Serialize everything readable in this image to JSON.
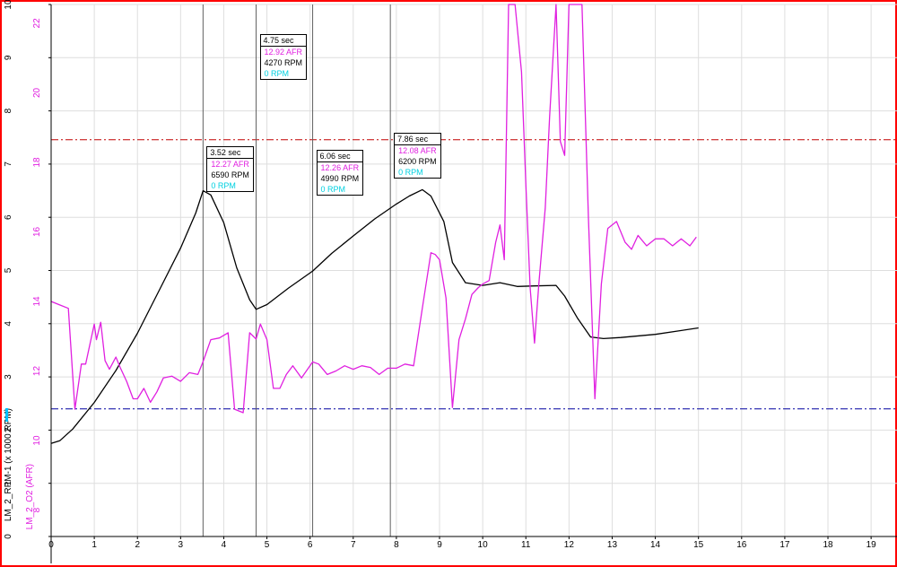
{
  "chart_data": {
    "type": "line",
    "xlabel": "",
    "x_ticks": [
      0,
      1,
      2,
      3,
      4,
      5,
      6,
      7,
      8,
      9,
      10,
      11,
      12,
      13,
      14,
      15,
      16,
      17,
      18,
      19
    ],
    "xlim": [
      0,
      19.6
    ],
    "axes": {
      "rpm": {
        "label": "LM_2_RPM-1 (x 1000 RPM)",
        "color": "#000000",
        "ticks": [
          0,
          1,
          2,
          3,
          4,
          5,
          6,
          7,
          8,
          9,
          10
        ],
        "ylim": [
          0,
          10
        ]
      },
      "afr": {
        "label": "LM_2_O2 (AFR)",
        "color": "#e020e0",
        "ticks": [
          8,
          10,
          12,
          14,
          16,
          18,
          20,
          22
        ],
        "ylim": [
          7.24,
          22.54
        ]
      }
    },
    "reference_lines": [
      {
        "axis": "afr",
        "value": 18.65,
        "color": "#c00000"
      },
      {
        "axis": "afr",
        "value": 10.91,
        "color": "#0000a0"
      }
    ],
    "series": [
      {
        "name": "LM_2_RPM-1",
        "axis": "rpm",
        "color": "#000000",
        "x": [
          0,
          0.2,
          0.5,
          1.0,
          1.5,
          2.0,
          2.5,
          3.0,
          3.35,
          3.52,
          3.7,
          4.0,
          4.3,
          4.6,
          4.75,
          5.0,
          5.5,
          6.06,
          6.5,
          7.0,
          7.5,
          8.0,
          8.3,
          8.6,
          8.8,
          9.1,
          9.3,
          9.6,
          10.0,
          10.4,
          10.8,
          11.2,
          11.7,
          11.9,
          12.2,
          12.5,
          12.8,
          13.2,
          14.0,
          14.5,
          15.0
        ],
        "y": [
          1.75,
          1.8,
          2.02,
          2.52,
          3.12,
          3.82,
          4.62,
          5.42,
          6.08,
          6.5,
          6.42,
          5.9,
          5.05,
          4.45,
          4.27,
          4.36,
          4.67,
          4.99,
          5.32,
          5.65,
          5.97,
          6.25,
          6.4,
          6.52,
          6.4,
          5.92,
          5.15,
          4.77,
          4.72,
          4.77,
          4.7,
          4.71,
          4.72,
          4.52,
          4.1,
          3.75,
          3.72,
          3.74,
          3.8,
          3.86,
          3.92
        ]
      },
      {
        "name": "LM_2_O2",
        "axis": "afr",
        "color": "#e020e0",
        "x": [
          0,
          0.2,
          0.4,
          0.55,
          0.7,
          0.8,
          1.0,
          1.05,
          1.15,
          1.25,
          1.35,
          1.5,
          1.6,
          1.75,
          1.9,
          2.0,
          2.15,
          2.3,
          2.45,
          2.6,
          2.8,
          3.0,
          3.2,
          3.4,
          3.52,
          3.7,
          3.9,
          4.1,
          4.25,
          4.45,
          4.6,
          4.75,
          4.85,
          5.0,
          5.15,
          5.3,
          5.45,
          5.6,
          5.8,
          6.06,
          6.2,
          6.4,
          6.6,
          6.8,
          7.0,
          7.2,
          7.4,
          7.6,
          7.8,
          8.0,
          8.2,
          8.4,
          8.6,
          8.8,
          8.9,
          9.0,
          9.15,
          9.3,
          9.45,
          9.6,
          9.75,
          9.9,
          10.0,
          10.15,
          10.3,
          10.4,
          10.5,
          10.6,
          10.75,
          10.9,
          11.0,
          11.1,
          11.2,
          11.3,
          11.45,
          11.55,
          11.7,
          11.8,
          11.9,
          12.0,
          12.1,
          12.3,
          12.45,
          12.6,
          12.75,
          12.9,
          13.1,
          13.3,
          13.45,
          13.6,
          13.8,
          14.0,
          14.2,
          14.4,
          14.6,
          14.8,
          14.95
        ],
        "y": [
          14.0,
          13.9,
          13.8,
          10.9,
          12.2,
          12.2,
          13.35,
          12.9,
          13.4,
          12.3,
          12.05,
          12.4,
          12.1,
          11.7,
          11.2,
          11.2,
          11.5,
          11.1,
          11.4,
          11.8,
          11.85,
          11.7,
          11.95,
          11.9,
          12.27,
          12.9,
          12.95,
          13.1,
          10.9,
          10.8,
          13.1,
          12.92,
          13.35,
          12.9,
          11.5,
          11.5,
          11.9,
          12.15,
          11.8,
          12.26,
          12.2,
          11.9,
          12.0,
          12.15,
          12.05,
          12.15,
          12.1,
          11.9,
          12.08,
          12.08,
          12.2,
          12.15,
          13.8,
          15.4,
          15.35,
          15.2,
          14.1,
          10.95,
          12.9,
          13.5,
          14.2,
          14.4,
          14.5,
          14.6,
          15.7,
          16.2,
          15.2,
          22.54,
          22.54,
          20.6,
          17.4,
          14.4,
          12.8,
          14.5,
          16.7,
          19.3,
          22.54,
          18.6,
          18.2,
          22.54,
          22.54,
          22.54,
          16.4,
          11.2,
          14.5,
          16.1,
          16.3,
          15.7,
          15.5,
          15.9,
          15.6,
          15.8,
          15.8,
          15.6,
          15.8,
          15.6,
          15.85
        ]
      }
    ],
    "cursors": [
      {
        "x": 3.52,
        "time": "3.52 sec",
        "afr": "12.27 AFR",
        "rpm": "6590 RPM",
        "rpm2": "0 RPM"
      },
      {
        "x": 4.75,
        "time": "4.75 sec",
        "afr": "12.92 AFR",
        "rpm": "4270 RPM",
        "rpm2": "0 RPM"
      },
      {
        "x": 6.06,
        "time": "6.06 sec",
        "afr": "12.26 AFR",
        "rpm": "4990 RPM",
        "rpm2": "0 RPM"
      },
      {
        "x": 7.86,
        "time": "7.86 sec",
        "afr": "12.08 AFR",
        "rpm": "6200 RPM",
        "rpm2": "0 RPM"
      }
    ],
    "colors": {
      "frame": "#ff0000",
      "grid": "#dedede",
      "cursor_line": "#606060",
      "rpm2": "#00d0e0"
    }
  }
}
